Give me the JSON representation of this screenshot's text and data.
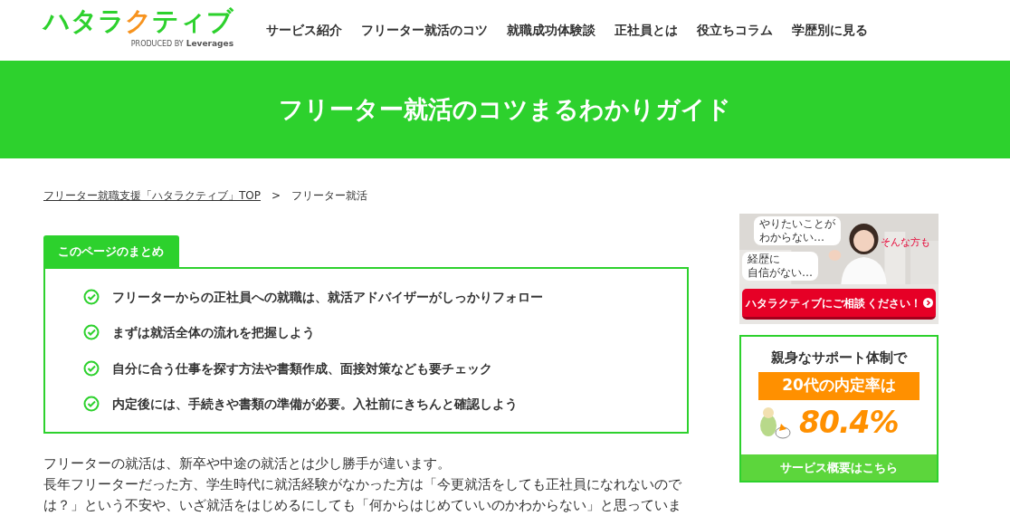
{
  "header": {
    "logo": [
      {
        "text": "ハタラ",
        "color": "#2dd12d"
      },
      {
        "text": "ク",
        "color": "#f7931e"
      },
      {
        "text": "ティブ",
        "color": "#2dd12d"
      }
    ],
    "logo_sub": "PRODUCED BY",
    "logo_brand": "Leverages",
    "nav": [
      "サービス紹介",
      "フリーター就活のコツ",
      "就職成功体験談",
      "正社員とは",
      "役立ちコラム",
      "学歴別に見る"
    ]
  },
  "hero": {
    "title": "フリーター就活のコツまるわかりガイド"
  },
  "breadcrumb": {
    "link": "フリーター就職支援「ハタラクティブ」TOP",
    "separator": ">",
    "current": "フリーター就活"
  },
  "summary": {
    "tab": "このページのまとめ",
    "items": [
      "フリーターからの正社員への就職は、就活アドバイザーがしっかりフォロー",
      "まずは就活全体の流れを把握しよう",
      "自分に合う仕事を探す方法や書類作成、面接対策なども要チェック",
      "内定後には、手続きや書類の準備が必要。入社前にきちんと確認しよう"
    ]
  },
  "body": [
    "フリーターの就活は、新卒や中途の就活とは少し勝手が違います。",
    "長年フリーターだった方、学生時代に就活経験がなかった方は「今更就活をしても正社員になれないのでは？」という不安や、いざ就活をはじめるにしても「何からはじめていいのかわからない」と思っていま"
  ],
  "sidebar": {
    "banner1": {
      "bubble1": [
        "やりたいことが",
        "わからない…"
      ],
      "bubble2": [
        "経歴に",
        "自信がない…"
      ],
      "tagline": "そんな方も",
      "button_main": "ハタラクティブにご相談",
      "button_small": "ください！"
    },
    "banner2": {
      "heading": "親身なサポート体制で",
      "highlight": "20代の内定率は",
      "rate": "80.4%",
      "link": "サービス概要はこちら"
    }
  }
}
